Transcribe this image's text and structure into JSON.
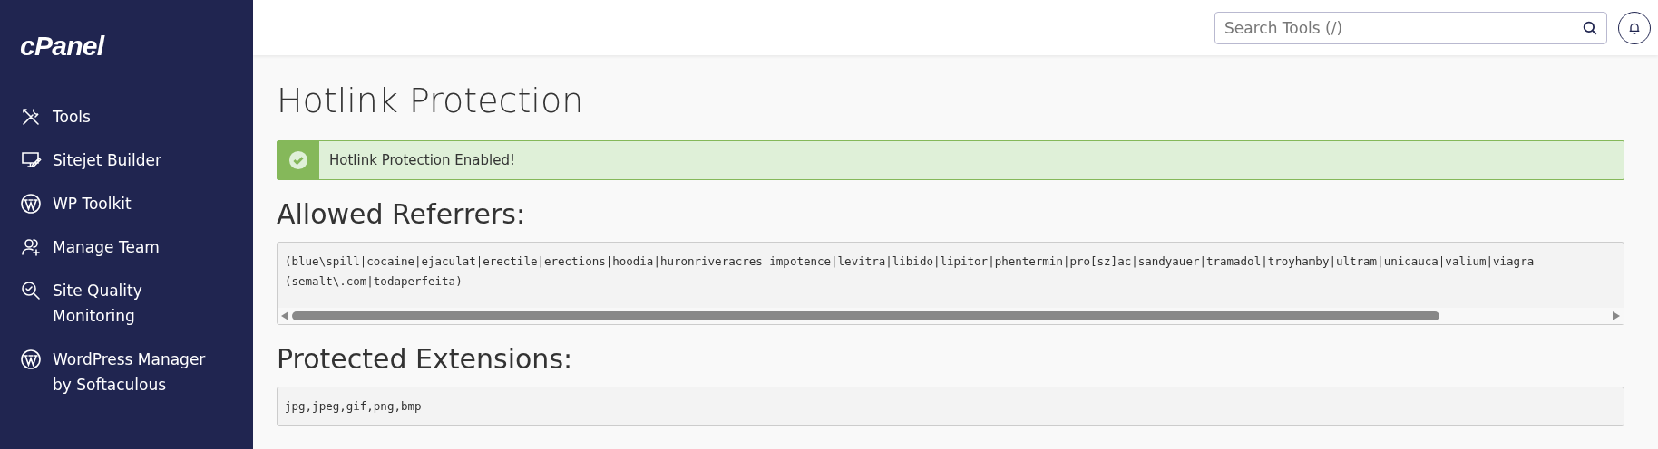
{
  "sidebar": {
    "logo": "cPanel",
    "items": [
      {
        "kind": "tools",
        "label": "Tools"
      },
      {
        "kind": "builder",
        "label": "Sitejet Builder"
      },
      {
        "kind": "wordpress",
        "label": "WP Toolkit"
      },
      {
        "kind": "team",
        "label": "Manage Team"
      },
      {
        "kind": "quality",
        "label": "Site Quality Monitoring"
      },
      {
        "kind": "wordpress",
        "label": "WordPress Manager by Softaculous"
      }
    ]
  },
  "header": {
    "search": {
      "placeholder": "Search Tools (/)"
    }
  },
  "page": {
    "title": "Hotlink Protection",
    "alert": {
      "kind": "success",
      "text": "Hotlink Protection Enabled!"
    },
    "sections": [
      {
        "heading": "Allowed Referrers:",
        "lines": [
          "(blue\\spill|cocaine|ejaculat|erectile|erections|hoodia|huronriveracres|impotence|levitra|libido|lipitor|phentermin|pro[sz]ac|sandyauer|tramadol|troyhamby|ultram|unicauca|valium|viagra",
          "(semalt\\.com|todaperfeita)"
        ],
        "scrollbar": true
      },
      {
        "heading": "Protected Extensions:",
        "lines": [
          "jpg,jpeg,gif,png,bmp"
        ],
        "scrollbar": false
      }
    ]
  }
}
